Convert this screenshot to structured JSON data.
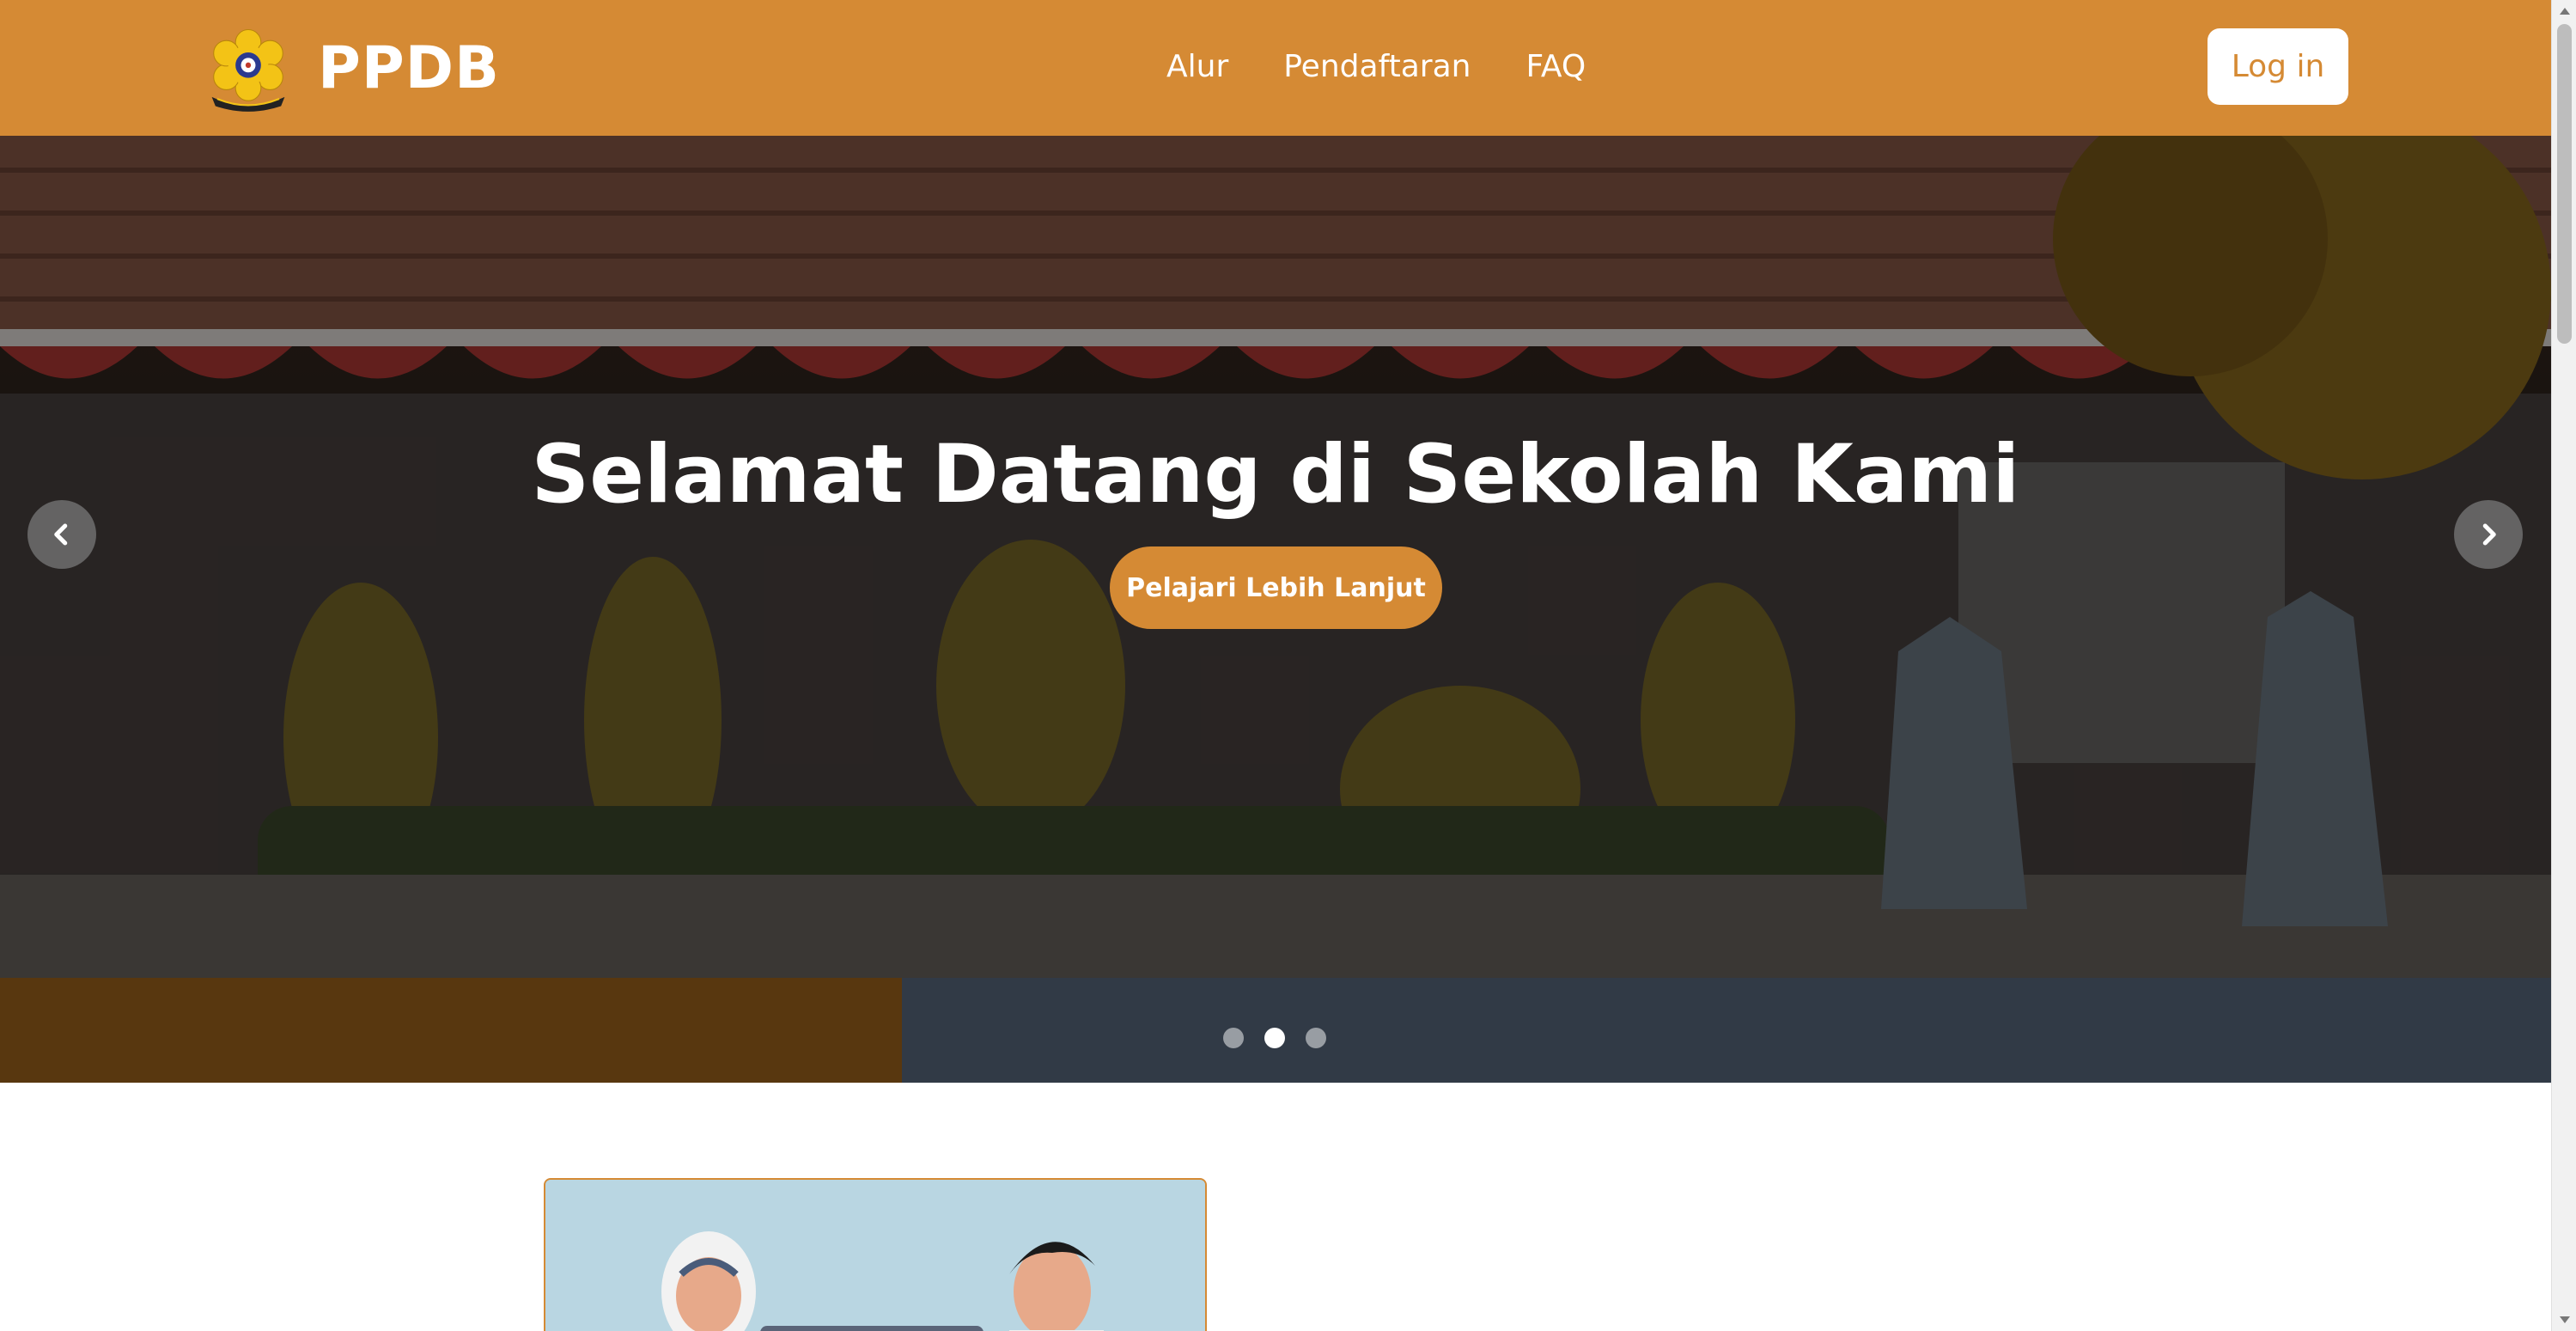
{
  "navbar": {
    "brand": "PPDB",
    "links": [
      "Alur",
      "Pendaftaran",
      "FAQ"
    ],
    "login_label": "Log in"
  },
  "hero": {
    "title": "Selamat Datang di Sekolah Kami",
    "cta_label": "Pelajari Lebih Lanjut",
    "slide_count": 3,
    "active_slide": 2
  },
  "colors": {
    "brand": "#d58a34",
    "text_on_brand": "#ffffff"
  },
  "icons": {
    "prev": "chevron-left-icon",
    "next": "chevron-right-icon",
    "scroll_up": "triangle-up-icon",
    "scroll_down": "triangle-down-icon"
  }
}
